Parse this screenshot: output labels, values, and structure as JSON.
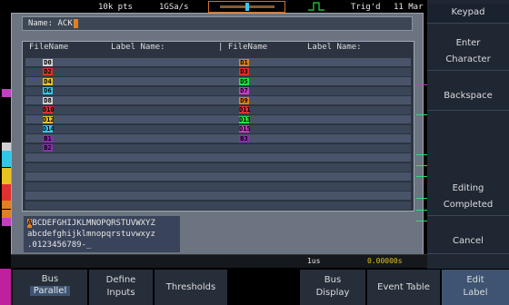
{
  "status": {
    "points": "10k pts",
    "rate": "1GSa/s",
    "trigger": "Trig'd",
    "date": "11 Mar"
  },
  "dialog": {
    "name_label": "Name: ACK",
    "headers": [
      "FileName",
      "Label Name:",
      "| FileName",
      "Label Name:"
    ],
    "left_chips": [
      {
        "text": "D0",
        "color": "#d0d0d0"
      },
      {
        "text": "D2",
        "color": "#e03030"
      },
      {
        "text": "D4",
        "color": "#e8c020"
      },
      {
        "text": "D6",
        "color": "#30c8e8"
      },
      {
        "text": "D8",
        "color": "#d0d0d0"
      },
      {
        "text": "D10",
        "color": "#e03030"
      },
      {
        "text": "D12",
        "color": "#e8c020"
      },
      {
        "text": "D14",
        "color": "#30c8e8"
      },
      {
        "text": "B1",
        "color": "#8a30b0"
      },
      {
        "text": "B2",
        "color": "#8a30b0"
      }
    ],
    "right_chips": [
      {
        "text": "D1",
        "color": "#e08020"
      },
      {
        "text": "D3",
        "color": "#e03030"
      },
      {
        "text": "D5",
        "color": "#20e040"
      },
      {
        "text": "D7",
        "color": "#c040c0"
      },
      {
        "text": "D9",
        "color": "#e08020"
      },
      {
        "text": "D11",
        "color": "#e03030"
      },
      {
        "text": "D13",
        "color": "#20e040"
      },
      {
        "text": "D15",
        "color": "#c040c0"
      },
      {
        "text": "B3",
        "color": "#8a30b0"
      }
    ],
    "charset_line1_sel": "A",
    "charset_line1_pre": "",
    "charset_line1_post": "BCDEFGHIJKLMNOPQRSTUVWXYZ",
    "charset_line2": "abcdefghijklmnopqrstuvwxyz",
    "charset_line3": ".0123456789-_"
  },
  "timebar": {
    "timebase": "1us",
    "offset": "0.00000s"
  },
  "side_keys": {
    "keypad": "Keypad",
    "enter_character_1": "Enter",
    "enter_character_2": "Character",
    "backspace": "Backspace",
    "editing_completed_1": "Editing",
    "editing_completed_2": "Completed",
    "cancel": "Cancel"
  },
  "bottom_menu": {
    "bus": "Bus",
    "bus_value": "Parallel",
    "define_inputs_1": "Define",
    "define_inputs_2": "Inputs",
    "thresholds": "Thresholds",
    "bus_display_1": "Bus",
    "bus_display_2": "Display",
    "event_table": "Event Table",
    "edit_label_1": "Edit",
    "edit_label_2": "Label"
  },
  "colors": {
    "accent": "#e08020",
    "background": "#000000",
    "dialog": "#6b7480",
    "menu": "#262e3a"
  }
}
